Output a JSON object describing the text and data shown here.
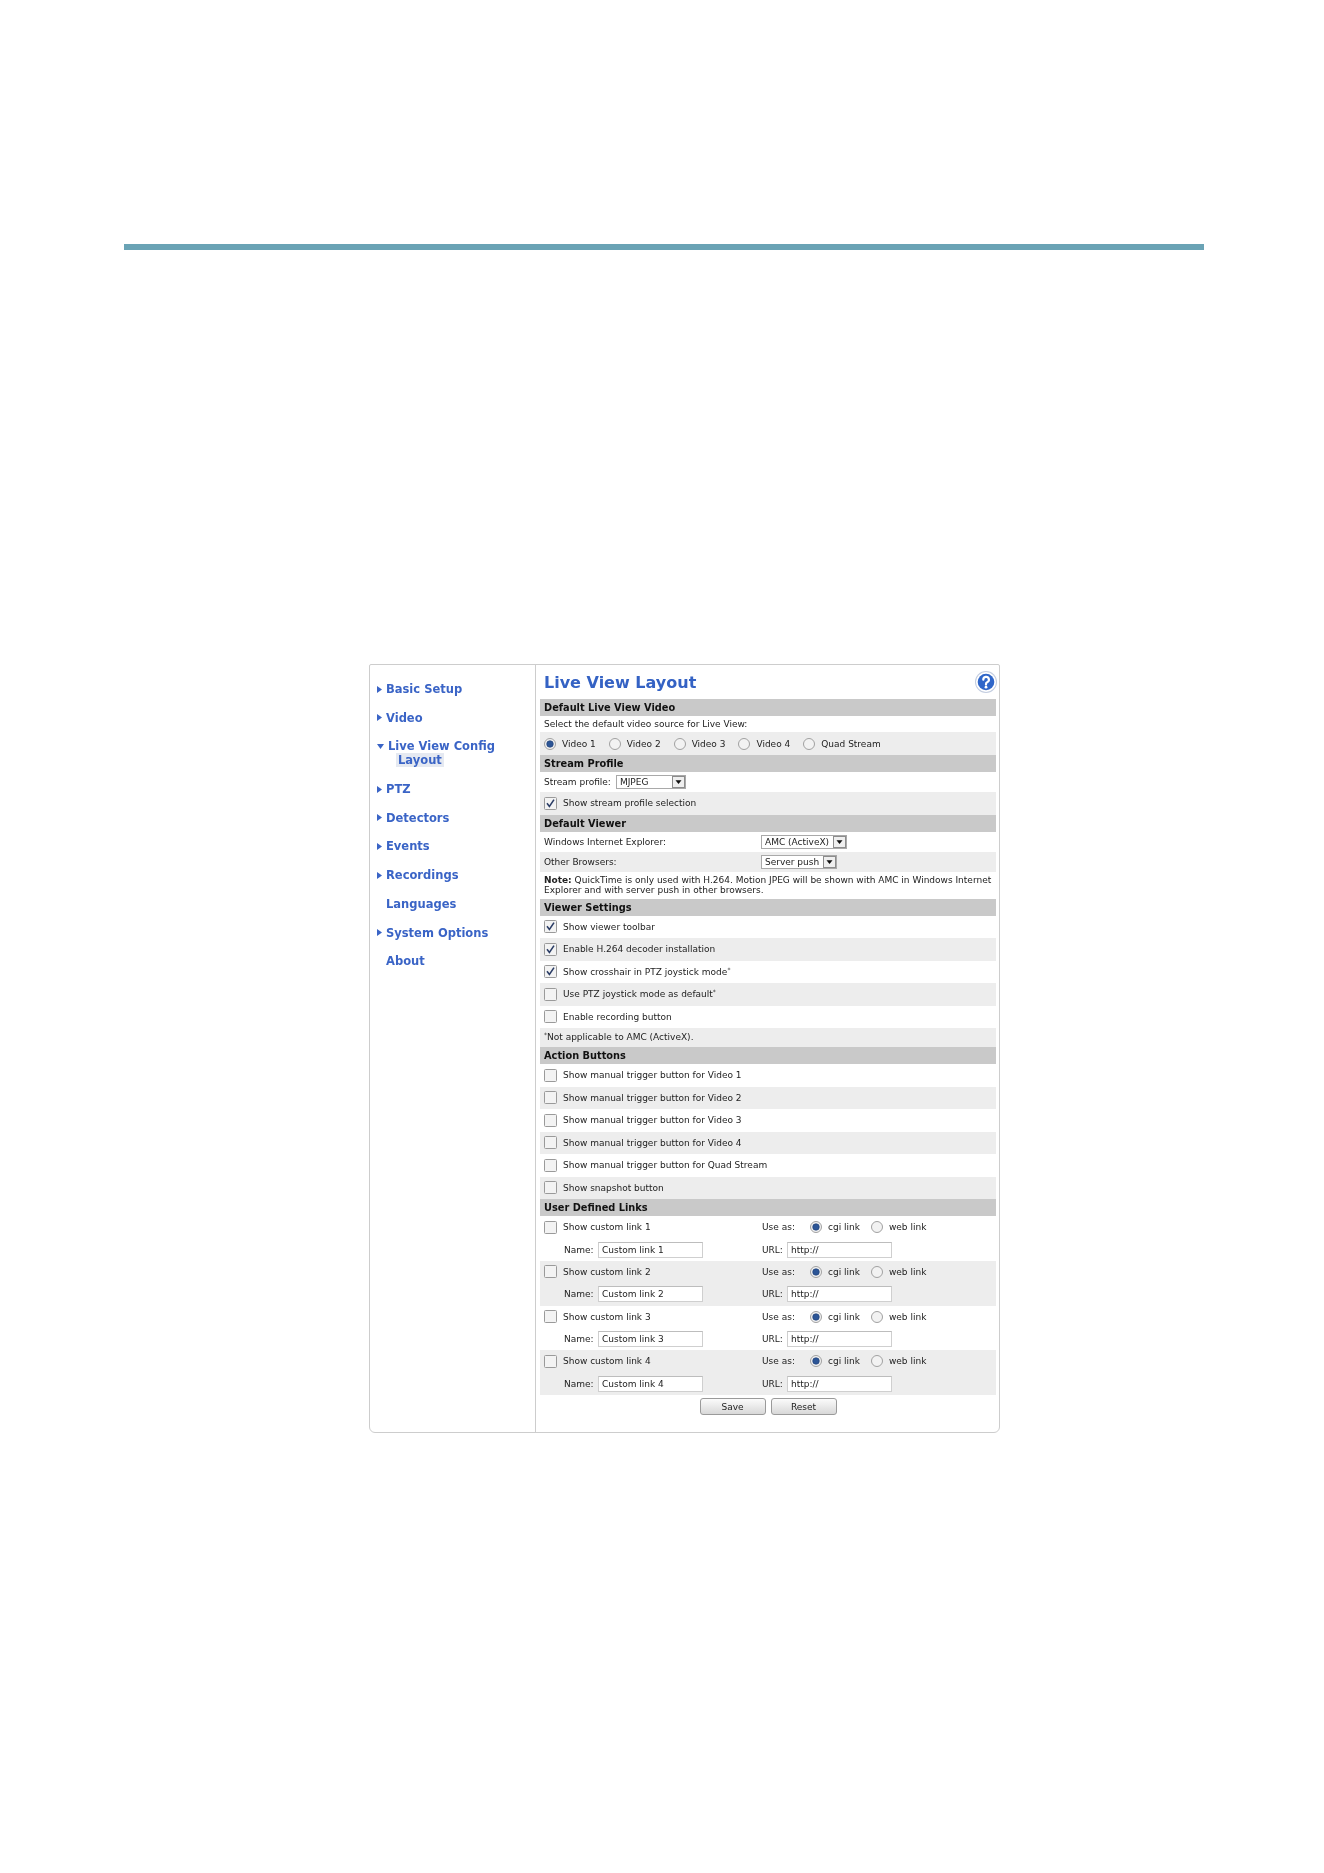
{
  "sidebar": {
    "items": [
      {
        "label": "Basic Setup",
        "kind": "section",
        "expanded": false,
        "selected": false
      },
      {
        "label": "Video",
        "kind": "section",
        "expanded": false,
        "selected": false
      },
      {
        "label": "Live View Config",
        "kind": "section",
        "expanded": true,
        "selected": false,
        "children": [
          {
            "label": "Layout",
            "selected": true
          }
        ]
      },
      {
        "label": "PTZ",
        "kind": "section",
        "expanded": false,
        "selected": false
      },
      {
        "label": "Detectors",
        "kind": "section",
        "expanded": false,
        "selected": false
      },
      {
        "label": "Events",
        "kind": "section",
        "expanded": false,
        "selected": false
      },
      {
        "label": "Recordings",
        "kind": "section",
        "expanded": false,
        "selected": false
      },
      {
        "label": "Languages",
        "kind": "page",
        "selected": false
      },
      {
        "label": "System Options",
        "kind": "section",
        "expanded": false,
        "selected": false
      },
      {
        "label": "About",
        "kind": "page",
        "selected": false
      }
    ]
  },
  "content": {
    "title": "Live View Layout",
    "sections": [
      {
        "title": "Default Live View Video",
        "rows": [
          {
            "kind": "text",
            "text": "Select the default video source for Live View:"
          },
          {
            "kind": "radios",
            "options": [
              {
                "label": "Video 1",
                "selected": true
              },
              {
                "label": "Video 2",
                "selected": false
              },
              {
                "label": "Video 3",
                "selected": false
              },
              {
                "label": "Video 4",
                "selected": false
              },
              {
                "label": "Quad Stream",
                "selected": false
              }
            ]
          }
        ]
      },
      {
        "title": "Stream Profile",
        "rows": [
          {
            "kind": "dropdown",
            "label": "Stream profile:",
            "value": "MJPEG"
          },
          {
            "kind": "checkbox",
            "label": "Show stream profile selection",
            "checked": true
          }
        ]
      },
      {
        "title": "Default Viewer",
        "rows": [
          {
            "kind": "picker",
            "label": "Windows Internet Explorer:",
            "value": "AMC (ActiveX)"
          },
          {
            "kind": "picker",
            "label": "Other Browsers:",
            "value": "Server push"
          },
          {
            "kind": "note",
            "text": "**Note:** QuickTime is only used with H.264. Motion JPEG will be shown with AMC in Windows Internet Explorer and with server push in other browsers."
          }
        ]
      },
      {
        "title": "Viewer Settings",
        "rows": [
          {
            "kind": "checkbox",
            "label": "Show viewer toolbar",
            "checked": true
          },
          {
            "kind": "checkbox",
            "label": "Enable H.264 decoder installation",
            "checked": true
          },
          {
            "kind": "checkbox",
            "label": "Show crosshair in PTZ joystick mode$^{*}$",
            "checked": true
          },
          {
            "kind": "checkbox",
            "label": "Use PTZ joystick mode as default$^{*}$",
            "checked": false
          },
          {
            "kind": "checkbox",
            "label": "Enable recording button",
            "checked": false
          },
          {
            "kind": "note",
            "text": "$^{*}$Not applicable to AMC (ActiveX)."
          }
        ]
      },
      {
        "title": "Action Buttons",
        "rows": [
          {
            "kind": "checkbox",
            "label": "Show manual trigger button for Video 1",
            "checked": false
          },
          {
            "kind": "checkbox",
            "label": "Show manual trigger button for Video 2",
            "checked": false
          },
          {
            "kind": "checkbox",
            "label": "Show manual trigger button for Video 3",
            "checked": false
          },
          {
            "kind": "checkbox",
            "label": "Show manual trigger button for Video 4",
            "checked": false
          },
          {
            "kind": "checkbox",
            "label": "Show manual trigger button for Quad Stream",
            "checked": false
          },
          {
            "kind": "checkbox",
            "label": "Show snapshot button",
            "checked": false
          }
        ]
      },
      {
        "title": "User Defined Links",
        "rows": [
          {
            "kind": "link",
            "label": "Show custom link 1",
            "checked": false,
            "use_label": "Use as:",
            "options": [
              {
                "label": "cgi link",
                "selected": true
              },
              {
                "label": "web link",
                "selected": false
              }
            ],
            "name_label": "Name:",
            "name": "Custom link 1",
            "url_label": "URL:",
            "url": "http://"
          },
          {
            "kind": "link",
            "label": "Show custom link 2",
            "checked": false,
            "use_label": "Use as:",
            "options": [
              {
                "label": "cgi link",
                "selected": true
              },
              {
                "label": "web link",
                "selected": false
              }
            ],
            "name_label": "Name:",
            "name": "Custom link 2",
            "url_label": "URL:",
            "url": "http://"
          },
          {
            "kind": "link",
            "label": "Show custom link 3",
            "checked": false,
            "use_label": "Use as:",
            "options": [
              {
                "label": "cgi link",
                "selected": true
              },
              {
                "label": "web link",
                "selected": false
              }
            ],
            "name_label": "Name:",
            "name": "Custom link 3",
            "url_label": "URL:",
            "url": "http://"
          },
          {
            "kind": "link",
            "label": "Show custom link 4",
            "checked": false,
            "use_label": "Use as:",
            "options": [
              {
                "label": "cgi link",
                "selected": true
              },
              {
                "label": "web link",
                "selected": false
              }
            ],
            "name_label": "Name:",
            "name": "Custom link 4",
            "url_label": "URL:",
            "url": "http://"
          }
        ]
      }
    ],
    "buttons": [
      "Save",
      "Reset"
    ]
  }
}
